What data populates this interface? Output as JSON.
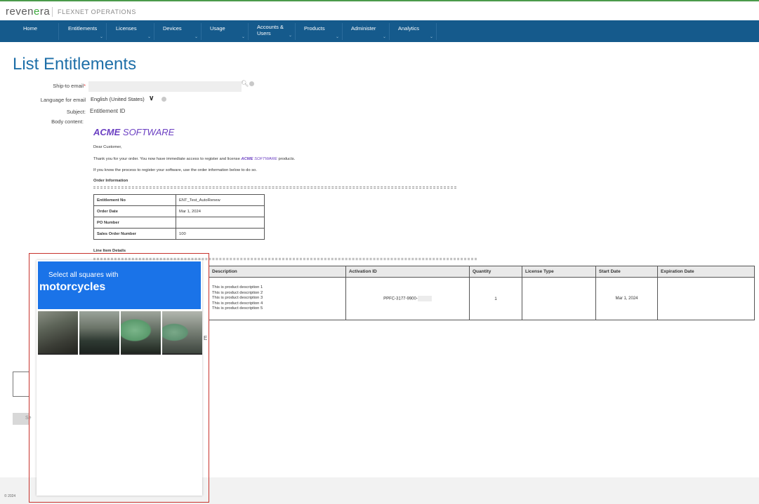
{
  "brand": {
    "logo_pre": "reven",
    "logo_dot": "e",
    "logo_post": "ra",
    "product": "FLEXNET OPERATIONS"
  },
  "nav": {
    "items": [
      {
        "label": "Home"
      },
      {
        "label": "Entitlements"
      },
      {
        "label": "Licenses"
      },
      {
        "label": "Devices"
      },
      {
        "label": "Usage"
      },
      {
        "label": "Accounts &\nUsers"
      },
      {
        "label": "Products"
      },
      {
        "label": "Administer"
      },
      {
        "label": "Analytics"
      }
    ]
  },
  "page": {
    "title": "List Entitlements"
  },
  "form": {
    "ship_to_label": "Ship-to email",
    "required_mark": "*",
    "ship_to_value": "",
    "language_label": "Language for email",
    "language_value": "English (United States)",
    "subject_label": "Subject:",
    "subject_value": "Entitlement ID",
    "body_label": "Body content:"
  },
  "email": {
    "acme_bold": "ACME",
    "acme_rest": " SOFTWARE",
    "greeting": "Dear Customer,",
    "thanks_pre": "Thank you for your  order. You now have immediate access to register and license ",
    "thanks_post": " products.",
    "instructions": "If you know the process to register your software, use the order information below to do so.",
    "order_info_heading": "Order Information",
    "line_items_heading": "Line Item Details"
  },
  "order_table": [
    {
      "key": "Entitlement No",
      "value": "ENT_Test_AutoRenew"
    },
    {
      "key": "Order Date",
      "value": "Mar 1, 2024"
    },
    {
      "key": "PO Number",
      "value": ""
    },
    {
      "key": "Sales Order Number",
      "value": "100"
    }
  ],
  "items_table": {
    "headers": [
      "Description",
      "Activation ID",
      "Quantity",
      "License Type",
      "Start Date",
      "Expiration Date"
    ],
    "rows": [
      {
        "description": [
          "This is product description 1",
          "This is product description 2",
          "This is product description 3",
          "This is product description 4",
          "This is product description 5"
        ],
        "activation_id": "PPFC-3177-9900-",
        "quantity": "1",
        "license_type": "",
        "start_date": "Mar 1, 2024",
        "expiration_date": ""
      }
    ]
  },
  "captcha": {
    "instruction": "Select all squares with",
    "target": "motorcycles"
  },
  "peek": {
    "button_fragment": "Se",
    "char": "E"
  },
  "footer": {
    "copyright": "© 2024"
  },
  "colors": {
    "nav_bg": "#155a8c",
    "title": "#1e6fa8",
    "acme": "#6b3fc2",
    "captcha_blue": "#1a73e8",
    "highlight_border": "#c8322c"
  }
}
